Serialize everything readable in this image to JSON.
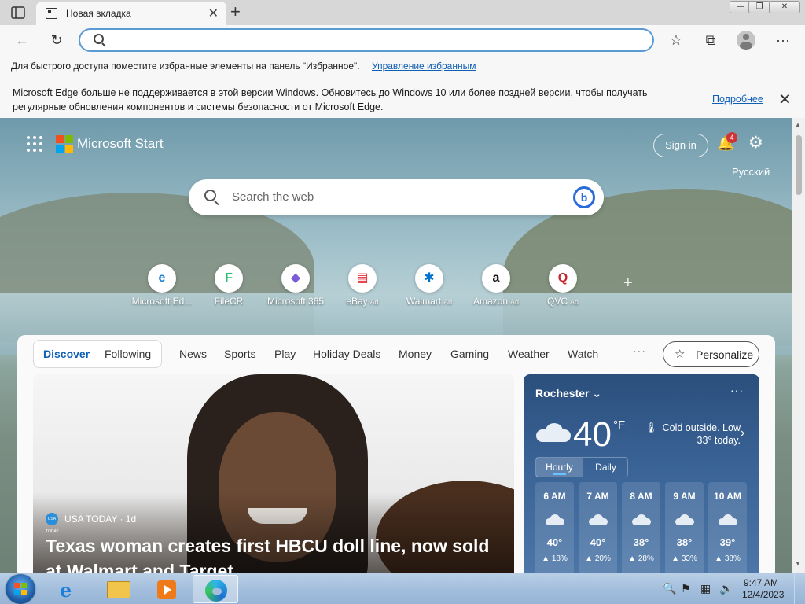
{
  "window": {
    "tab_title": "Новая вкладка",
    "tab_close": "✕",
    "new_tab": "+",
    "minimize": "—",
    "maximize": "❐",
    "close": "✕"
  },
  "toolbar": {
    "back": "←",
    "refresh": "↻",
    "address_value": "",
    "favorites_star": "☆",
    "collections": "⧉",
    "menu": "···"
  },
  "favorites_bar": {
    "message": "Для быстрого доступа поместите избранные элементы на панель \"Избранное\".",
    "link": "Управление избранным"
  },
  "info_bar": {
    "text": "Microsoft Edge больше не поддерживается в этой версии Windows. Обновитесь до Windows 10 или более поздней версии, чтобы получать регулярные обновления компонентов и системы безопасности от Microsoft Edge.",
    "more_link": "Подробнее",
    "close": "✕"
  },
  "start_page": {
    "brand": "Microsoft Start",
    "signin": "Sign in",
    "notification_count": "4",
    "language": "Русский",
    "search_placeholder": "Search the web",
    "bing_glyph": "b",
    "quick_links": [
      {
        "label": "Microsoft Ed...",
        "glyph": "e",
        "color": "#1b7fd4",
        "ad": ""
      },
      {
        "label": "FileCR",
        "glyph": "F",
        "color": "#2fbf71",
        "ad": ""
      },
      {
        "label": "Microsoft 365",
        "glyph": "◆",
        "color": "#7a5cd6",
        "ad": ""
      },
      {
        "label": "eBay",
        "glyph": "▤",
        "color": "#e53238",
        "ad": "Ad"
      },
      {
        "label": "Walmart",
        "glyph": "✱",
        "color": "#0071ce",
        "ad": "Ad"
      },
      {
        "label": "Amazon",
        "glyph": "a",
        "color": "#111111",
        "ad": "Ad"
      },
      {
        "label": "QVC",
        "glyph": "Q",
        "color": "#c1272d",
        "ad": "Ad"
      }
    ],
    "add_link": "+"
  },
  "feed": {
    "pill_active": "Discover",
    "pill_other": "Following",
    "categories": [
      "News",
      "Sports",
      "Play",
      "Holiday Deals",
      "Money",
      "Gaming",
      "Weather",
      "Watch"
    ],
    "more": "···",
    "personalize": "Personalize",
    "story": {
      "source_badge": "USA TODAY",
      "source": "USA TODAY · 1d",
      "headline": "Texas woman creates first HBCU doll line, now sold at Walmart and Target"
    }
  },
  "weather": {
    "city": "Rochester",
    "chevron": "⌄",
    "more": "···",
    "temp": "40",
    "unit": "°F",
    "description": "Cold outside. Low 33° today.",
    "tab_hourly": "Hourly",
    "tab_daily": "Daily",
    "hours": [
      {
        "time": "6 AM",
        "temp": "40°",
        "precip": "▲ 18%"
      },
      {
        "time": "7 AM",
        "temp": "40°",
        "precip": "▲ 20%"
      },
      {
        "time": "8 AM",
        "temp": "38°",
        "precip": "▲ 28%"
      },
      {
        "time": "9 AM",
        "temp": "38°",
        "precip": "▲ 33%"
      },
      {
        "time": "10 AM",
        "temp": "39°",
        "precip": "▲ 38%"
      }
    ]
  },
  "taskbar": {
    "time": "9:47 AM",
    "date": "12/4/2023",
    "ie_glyph": "e",
    "tray_icons": [
      "🔍",
      "⚑",
      "▦",
      "🔊"
    ]
  }
}
